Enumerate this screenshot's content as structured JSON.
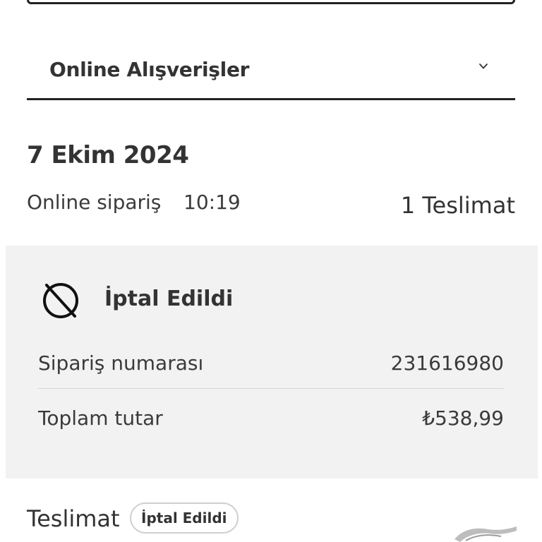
{
  "purchases_filter": {
    "selected": "Online Alışverişler"
  },
  "order": {
    "date": "7 Ekim 2024",
    "type": "Online sipariş",
    "time": "10:19",
    "delivery_count": "1 Teslimat",
    "status": "İptal Edildi",
    "details": [
      {
        "label": "Sipariş numarası",
        "value": "231616980"
      },
      {
        "label": "Toplam tutar",
        "value": "₺538,99"
      }
    ]
  },
  "delivery": {
    "label": "Teslimat",
    "status_badge": "İptal Edildi"
  },
  "icons": {
    "dropdown": "chevron-down-icon",
    "status": "cancelled-icon"
  }
}
